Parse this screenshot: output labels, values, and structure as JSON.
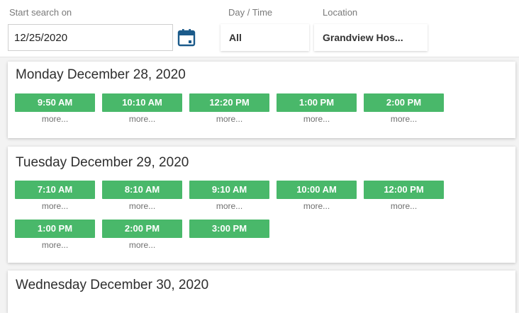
{
  "filters": {
    "start_label": "Start search on",
    "start_value": "12/25/2020",
    "day_time_label": "Day / Time",
    "day_time_value": "All",
    "location_label": "Location",
    "location_value": "Grandview Hos..."
  },
  "days": [
    {
      "title": "Monday December 28, 2020",
      "slots": [
        {
          "time": "9:50 AM",
          "more": "more..."
        },
        {
          "time": "10:10 AM",
          "more": "more..."
        },
        {
          "time": "12:20 PM",
          "more": "more..."
        },
        {
          "time": "1:00 PM",
          "more": "more..."
        },
        {
          "time": "2:00 PM",
          "more": "more..."
        }
      ]
    },
    {
      "title": "Tuesday December 29, 2020",
      "slots": [
        {
          "time": "7:10 AM",
          "more": "more..."
        },
        {
          "time": "8:10 AM",
          "more": "more..."
        },
        {
          "time": "9:10 AM",
          "more": "more..."
        },
        {
          "time": "10:00 AM",
          "more": "more..."
        },
        {
          "time": "12:00 PM",
          "more": "more..."
        },
        {
          "time": "1:00 PM",
          "more": "more..."
        },
        {
          "time": "2:00 PM",
          "more": "more..."
        },
        {
          "time": "3:00 PM",
          "more": ""
        }
      ]
    },
    {
      "title": "Wednesday December 30, 2020",
      "slots": []
    }
  ],
  "colors": {
    "slot_green": "#49b86a",
    "calendar_blue": "#1b5a8a"
  }
}
